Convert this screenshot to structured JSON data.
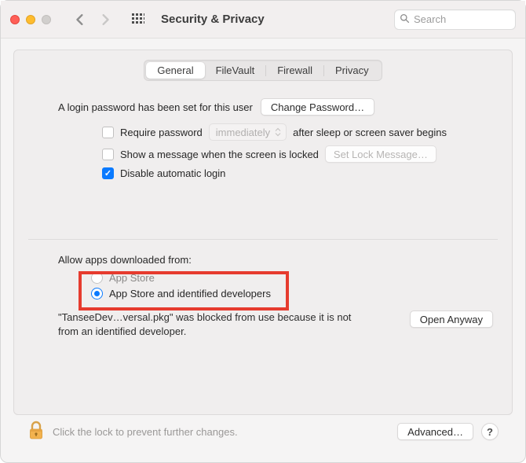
{
  "window": {
    "title": "Security & Privacy"
  },
  "search": {
    "placeholder": "Search"
  },
  "tabs": {
    "general": "General",
    "filevault": "FileVault",
    "firewall": "Firewall",
    "privacy": "Privacy"
  },
  "general": {
    "login_set_text": "A login password has been set for this user",
    "change_password_btn": "Change Password…",
    "require_password_label": "Require password",
    "require_password_delay": "immediately",
    "after_sleep_text": "after sleep or screen saver begins",
    "show_message_label": "Show a message when the screen is locked",
    "set_lock_message_btn": "Set Lock Message…",
    "disable_auto_login_label": "Disable automatic login",
    "allow_apps_label": "Allow apps downloaded from:",
    "radio_app_store": "App Store",
    "radio_identified": "App Store and identified developers",
    "blocked_text": "\"TanseeDev…versal.pkg\" was blocked from use because it is not from an identified developer.",
    "open_anyway_btn": "Open Anyway"
  },
  "footer": {
    "lock_text": "Click the lock to prevent further changes.",
    "advanced_btn": "Advanced…",
    "help": "?"
  }
}
